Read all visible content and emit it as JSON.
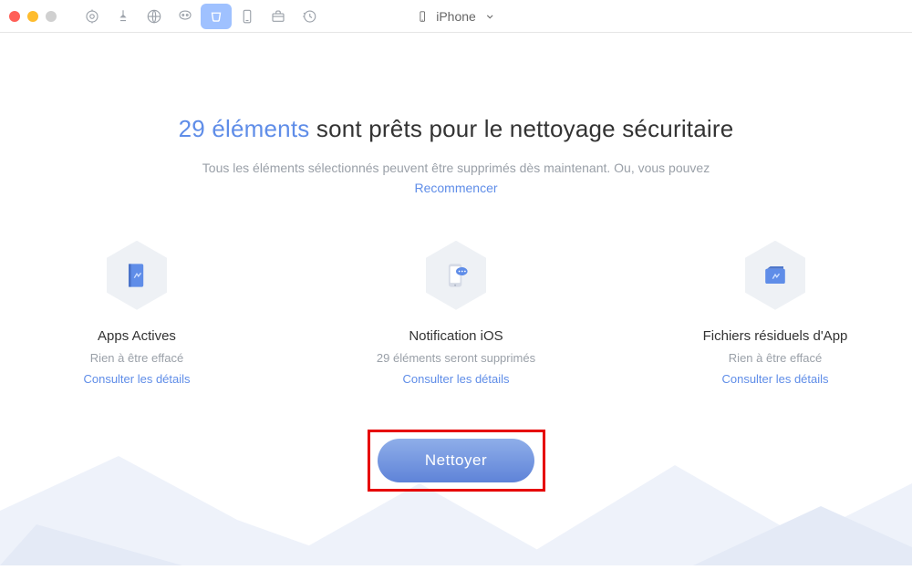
{
  "device": {
    "label": "iPhone"
  },
  "headline": {
    "count": "29 éléments",
    "rest": " sont prêts pour le nettoyage sécuritaire"
  },
  "subtitle": "Tous les éléments sélectionnés peuvent être supprimés dès maintenant. Ou, vous pouvez",
  "restart_label": "Recommencer",
  "cards": [
    {
      "title": "Apps Actives",
      "status": "Rien à être effacé",
      "link": "Consulter les détails"
    },
    {
      "title": "Notification iOS",
      "status": "29 éléments seront supprimés",
      "link": "Consulter les détails"
    },
    {
      "title": "Fichiers résiduels d'App",
      "status": "Rien à être effacé",
      "link": "Consulter les détails"
    }
  ],
  "clean_button": "Nettoyer",
  "colors": {
    "accent": "#5f8de8",
    "highlight_border": "#e60000"
  }
}
